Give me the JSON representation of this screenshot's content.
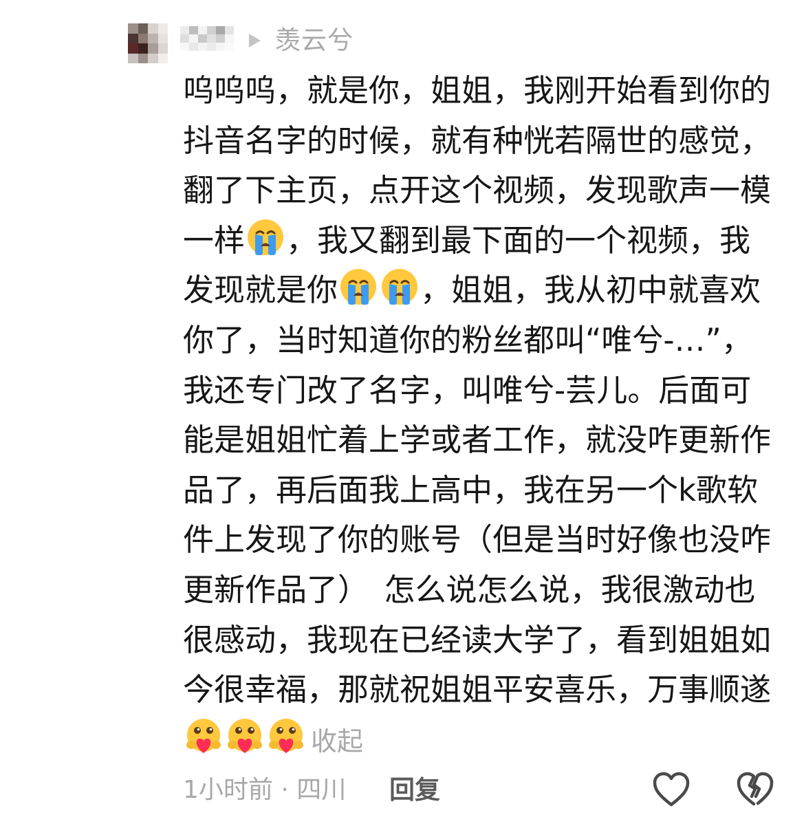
{
  "header": {
    "avatar_icon": "blurred-avatar",
    "reply_arrow_icon": "triangle-right",
    "reply_target": "羡云兮"
  },
  "comment": {
    "segments": [
      {
        "type": "text",
        "value": "呜呜呜，就是你，姐姐，我刚开始看到你的抖音名字的时候，就有种恍若隔世的感觉，翻了下主页，点开这个视频，发现歌声一模一样"
      },
      {
        "type": "emoji",
        "name": "crying-face"
      },
      {
        "type": "text",
        "value": "，我又翻到最下面的一个视频，我发现就是你"
      },
      {
        "type": "emoji",
        "name": "crying-face"
      },
      {
        "type": "emoji",
        "name": "crying-face"
      },
      {
        "type": "text",
        "value": "，姐姐，我从初中就喜欢你了，当时知道你的粉丝都叫“唯兮-…”，我还专门改了名字，叫唯兮-芸儿。后面可能是姐姐忙着上学或者工作，就没咋更新作品了，再后面我上高中，我在另一个k歌软件上发现了你的账号（但是当时好像也没咋更新作品了）　怎么说怎么说，我很激动也很感动，我现在已经读大学了，看到姐姐如今很幸福，那就祝姐姐平安喜乐，万事顺遂"
      },
      {
        "type": "emoji",
        "name": "heart-hug-face"
      },
      {
        "type": "emoji",
        "name": "heart-hug-face"
      },
      {
        "type": "emoji",
        "name": "heart-hug-face"
      }
    ],
    "collapse_label": "收起"
  },
  "footer": {
    "meta": "1小时前 · 四川",
    "reply_label": "回复",
    "like_icon": "heart-outline",
    "dislike_icon": "broken-heart-outline"
  },
  "colors": {
    "text": "#161616",
    "muted": "#a8a8a8",
    "reply": "#5b5b5b",
    "emoji_face": "#ffc83d",
    "emoji_tear": "#3d9bf0",
    "emoji_heart": "#ff2d55"
  }
}
